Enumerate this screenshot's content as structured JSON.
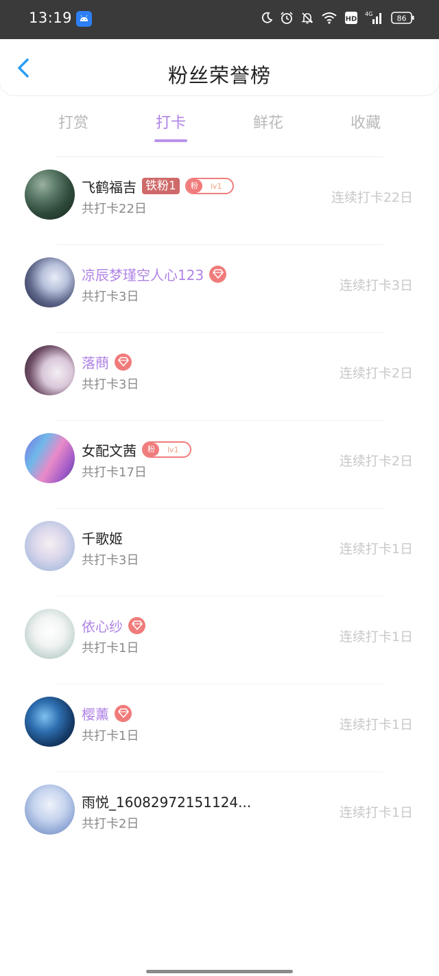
{
  "status_bar": {
    "time": "13:19",
    "battery": "86",
    "network": "4G",
    "hd": "HD",
    "icons": [
      "android-app-icon",
      "moon-icon",
      "alarm-icon",
      "mute-bell-icon",
      "wifi-icon",
      "hd-icon",
      "signal-icon",
      "battery-icon"
    ]
  },
  "header": {
    "title": "粉丝荣誉榜",
    "back_icon": "chevron-left-icon"
  },
  "tabs": [
    {
      "label": "打赏",
      "active": false
    },
    {
      "label": "打卡",
      "active": true
    },
    {
      "label": "鲜花",
      "active": false
    },
    {
      "label": "收藏",
      "active": false
    }
  ],
  "fans": [
    {
      "name": "飞鹤福吉",
      "name_color": "dark",
      "iron_tag": "铁粉1",
      "fan_badge": {
        "left": "粉",
        "right": "lv1"
      },
      "gem": false,
      "total": "共打卡22日",
      "streak": "连续打卡22日"
    },
    {
      "name": "凉辰梦瑾空人心123",
      "name_color": "purple",
      "gem": true,
      "total": "共打卡3日",
      "streak": "连续打卡3日"
    },
    {
      "name": "落蔄",
      "name_color": "purple",
      "gem": true,
      "total": "共打卡3日",
      "streak": "连续打卡2日"
    },
    {
      "name": "女配文茜",
      "name_color": "dark",
      "fan_badge": {
        "left": "粉",
        "right": "lv1"
      },
      "gem": false,
      "total": "共打卡17日",
      "streak": "连续打卡2日"
    },
    {
      "name": "千歌姬",
      "name_color": "dark",
      "gem": false,
      "total": "共打卡3日",
      "streak": "连续打卡1日"
    },
    {
      "name": "依心纱",
      "name_color": "purple",
      "gem": true,
      "total": "共打卡1日",
      "streak": "连续打卡1日"
    },
    {
      "name": "樱薰",
      "name_color": "purple",
      "gem": true,
      "total": "共打卡1日",
      "streak": "连续打卡1日"
    },
    {
      "name": "雨悦_16082972151124...",
      "name_color": "dark",
      "gem": false,
      "total": "共打卡2日",
      "streak": "连续打卡1日"
    }
  ],
  "colors": {
    "accent": "#b083e6",
    "badge_red": "#f07b7b",
    "iron_red": "#cf6a6a"
  }
}
